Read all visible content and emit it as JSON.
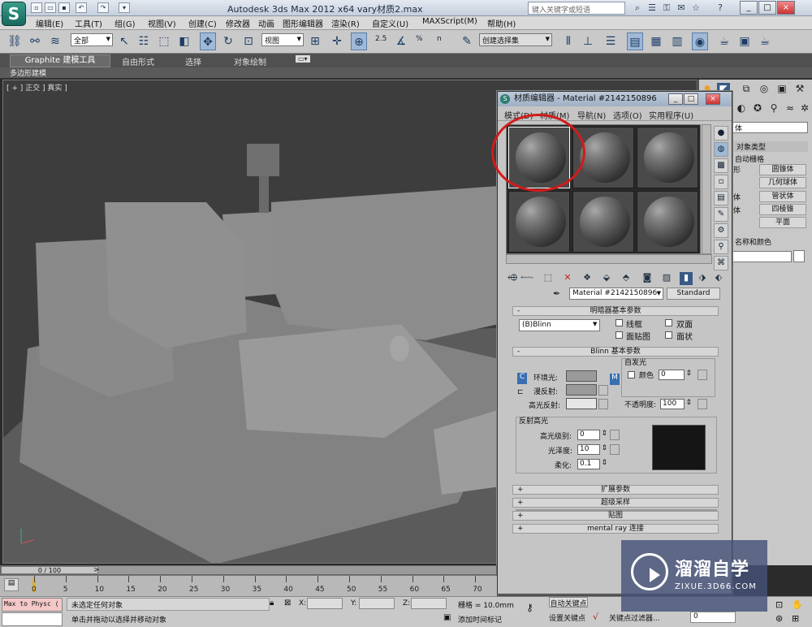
{
  "app": {
    "logo": "S",
    "title": "Autodesk 3ds Max  2012 x64      vary材质2.max",
    "search_placeholder": "键入关键字或短语",
    "win_buttons": [
      "_",
      "□",
      "×"
    ]
  },
  "menu": [
    "编辑(E)",
    "工具(T)",
    "组(G)",
    "视图(V)",
    "创建(C)",
    "修改器",
    "动画",
    "图形编辑器",
    "渲染(R)",
    "自定义(U)",
    "MAXScript(M)",
    "帮助(H)"
  ],
  "toolbar": {
    "filter": "全部",
    "view": "视图",
    "snap_values": [
      "2.5",
      "%",
      "n"
    ],
    "selection_set": "创建选择集"
  },
  "ribbon": {
    "tabs": [
      "Graphite 建模工具",
      "自由形式",
      "选择",
      "对象绘制"
    ],
    "sub": "多边形建模"
  },
  "viewport": {
    "label": "[ + ] 正交 ] 真实 ]"
  },
  "command_panel": {
    "dropdown": "体",
    "section_title": "对象类型",
    "autogrid": "自动栅格",
    "objects": [
      "圆锥体",
      "几何球体",
      "管状体",
      "四棱锥",
      "平面"
    ],
    "left_cut": [
      "形",
      "体",
      "体"
    ],
    "name_color_title": "名称和颜色"
  },
  "material_editor": {
    "title": "材质编辑器 - Material #2142150896",
    "menu": [
      "模式(D)",
      "材质(M)",
      "导航(N)",
      "选项(O)",
      "实用程序(U)"
    ],
    "material_name": "Material #2142150896",
    "material_type": "Standard",
    "shader_rollout": "明暗器基本参数",
    "shader": "(B)Blinn",
    "shader_options": [
      "线框",
      "双面",
      "面贴图",
      "面状"
    ],
    "blinn_rollout": "Blinn 基本参数",
    "self_illum_title": "自发光",
    "self_illum_color_label": "颜色",
    "self_illum_value": "0",
    "ambient_label": "环境光:",
    "diffuse_label": "漫反射:",
    "specular_label": "高光反射:",
    "opacity_label": "不透明度:",
    "opacity_value": "100",
    "highlight_title": "反射高光",
    "specular_level_label": "高光级别:",
    "specular_level_value": "0",
    "glossiness_label": "光泽度:",
    "glossiness_value": "10",
    "soften_label": "柔化:",
    "soften_value": "0.1",
    "lock_letters": [
      "C",
      "M"
    ],
    "collapsed_rollouts": [
      "扩展参数",
      "超级采样",
      "贴图",
      "mental ray 连接"
    ]
  },
  "timeline": {
    "frame": "0 / 100",
    "ticks": [
      "0",
      "5",
      "10",
      "15",
      "20",
      "25",
      "30",
      "35",
      "40",
      "45",
      "50",
      "55",
      "60",
      "65",
      "70"
    ]
  },
  "status": {
    "listener": "Max to Physc (",
    "selection": "未选定任何对象",
    "prompt": "单击并拖动以选择并移动对象",
    "x_label": "X:",
    "y_label": "Y:",
    "z_label": "Z:",
    "grid": "栅格 = 10.0mm",
    "add_time_tag": "添加时间标记",
    "auto_key": "自动关键点",
    "set_key": "设置关键点",
    "key_filters": "关键点过滤器...",
    "frame_field": "0"
  },
  "watermark": {
    "title": "溜溜自学",
    "subtitle": "ZIXUE.3D66.COM"
  },
  "colors": {
    "ambient": "#9a9a9a",
    "diffuse": "#9a9a9a",
    "specular": "#e6e6e6",
    "highlight_preview": "#151515",
    "annotation": "#d21b1b"
  }
}
